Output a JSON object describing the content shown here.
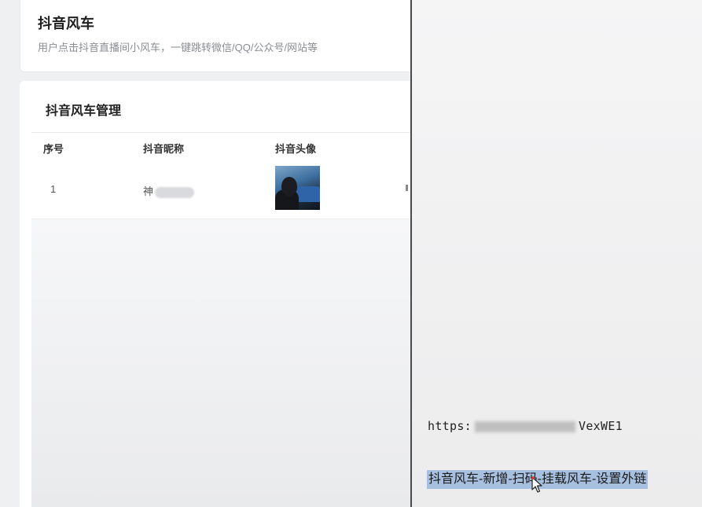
{
  "header": {
    "title": "抖音风车",
    "description": "用户点击抖音直播间小风车，一键跳转微信/QQ/公众号/网站等"
  },
  "panel": {
    "title": "抖音风车管理",
    "columns": [
      "序号",
      "抖音昵称",
      "抖音头像"
    ],
    "rows": [
      {
        "index": "1",
        "nickname": "神"
      }
    ]
  },
  "notes": {
    "url_start": "https:",
    "url_end": "VexWE1",
    "steps": "抖音风车-新增-扫码-挂载风车-设置外链"
  },
  "icons": {
    "cursor": "mouse-pointer-icon"
  }
}
